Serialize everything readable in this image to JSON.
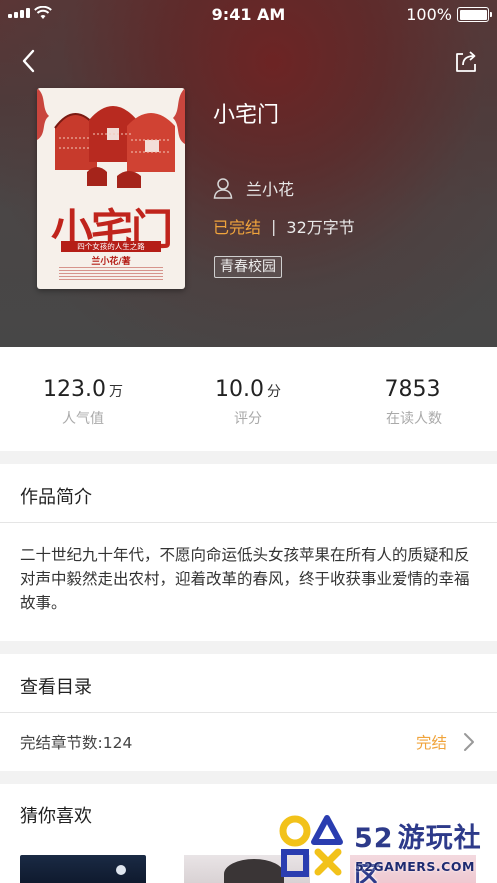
{
  "status_bar": {
    "time": "9:41 AM",
    "battery": "100%"
  },
  "book": {
    "title": "小宅门",
    "author": "兰小花",
    "status": "已完结",
    "separator": "|",
    "word_count": "32万字节",
    "tag": "青春校园"
  },
  "cover": {
    "title": "小宅门",
    "subtitle": "四个女孩的人生之路",
    "author": "兰小花/著"
  },
  "stats": [
    {
      "value": "123.0",
      "unit": "万",
      "label": "人气值"
    },
    {
      "value": "10.0",
      "unit": "分",
      "label": "评分"
    },
    {
      "value": "7853",
      "unit": "",
      "label": "在读人数"
    }
  ],
  "intro": {
    "title": "作品简介",
    "body": "二十世纪九十年代，不愿向命运低头女孩苹果在所有人的质疑和反对声中毅然走出农村，迎着改革的春风，终于收获事业爱情的幸福故事。"
  },
  "toc": {
    "title": "查看目录",
    "chapters": "完结章节数:124",
    "status": "完结"
  },
  "guess": {
    "title": "猜你喜欢"
  },
  "watermark": {
    "brand_num": "52",
    "brand_text": "游玩社区",
    "url": "52GAMERS.COM"
  },
  "colors": {
    "accent": "#f0a43c",
    "hero_bg": "#4e3a3a",
    "cover_red": "#c0241c"
  }
}
